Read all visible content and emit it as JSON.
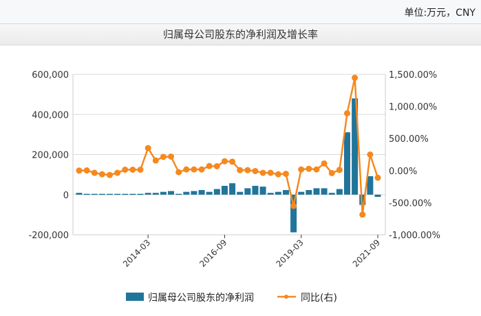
{
  "unit_label": "单位:万元，CNY",
  "chart_data": {
    "type": "bar+line",
    "title": "归属母公司股东的净利润及增长率",
    "x_ticks": [
      "2014-03",
      "2016-09",
      "2019-03",
      "2021-09"
    ],
    "x_start": "2011-12",
    "x_step": "quarter",
    "y_left": {
      "ticks": [
        "600,000",
        "400,000",
        "200,000",
        "0",
        "-200,000"
      ],
      "ylim": [
        -200000,
        600000
      ]
    },
    "y_right": {
      "ticks": [
        "1,500.00%",
        "1,000.00%",
        "500.00%",
        "0.00%",
        "-500.00%",
        "-1,000.00%"
      ],
      "ylim": [
        -1000,
        1500
      ]
    },
    "series": [
      {
        "name": "归属母公司股东的净利润",
        "type": "bar",
        "color": "#21759b",
        "values": [
          9000,
          4000,
          4000,
          4000,
          4000,
          4000,
          4000,
          4000,
          4000,
          9000,
          9000,
          14000,
          18000,
          4000,
          14000,
          18000,
          23000,
          14000,
          28000,
          44000,
          57000,
          14000,
          32000,
          44000,
          40000,
          9000,
          14000,
          23000,
          -188000,
          14000,
          23000,
          32000,
          32000,
          9000,
          28000,
          311000,
          480000,
          -51000,
          92000,
          -11000
        ]
      },
      {
        "name": "同比(右)",
        "type": "line",
        "color": "#f5891f",
        "values": [
          0,
          3,
          -35,
          -57,
          -68,
          -35,
          14,
          14,
          14,
          350,
          157,
          214,
          218,
          -25,
          18,
          18,
          18,
          71,
          68,
          146,
          139,
          7,
          7,
          -7,
          -35,
          -35,
          -57,
          -50,
          -550,
          18,
          28,
          18,
          111,
          -39,
          11,
          893,
          1446,
          -686,
          250,
          -111
        ]
      }
    ],
    "legend": "bottom"
  }
}
